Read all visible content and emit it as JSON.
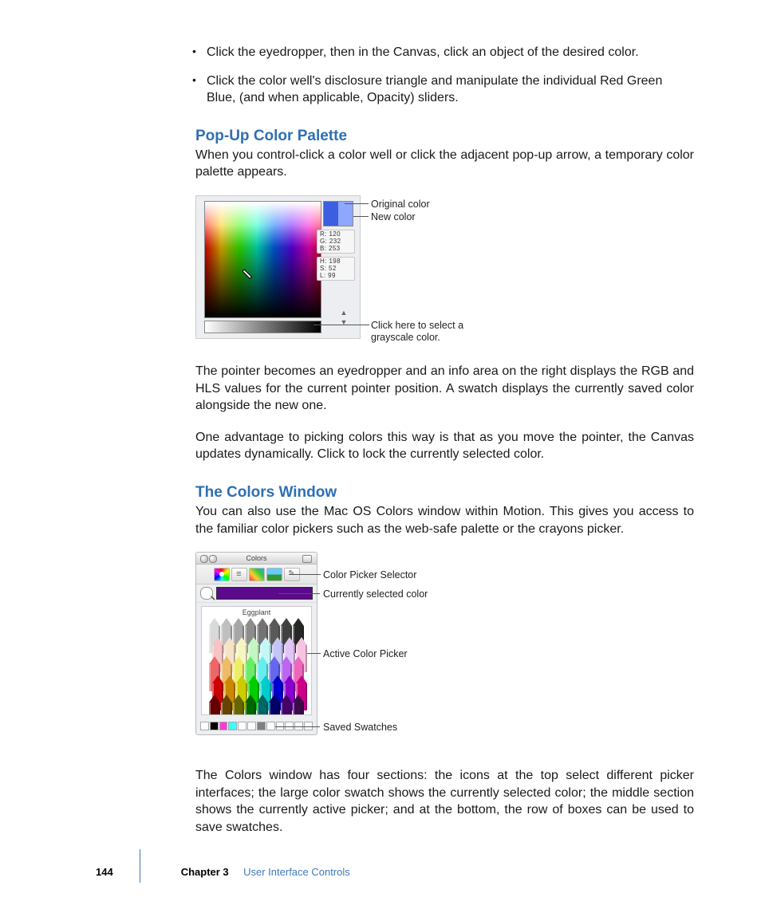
{
  "bullets": [
    "Click the eyedropper, then in the Canvas, click an object of the desired color.",
    "Click the color well's disclosure triangle and manipulate the individual Red Green Blue, (and when applicable, Opacity) sliders."
  ],
  "section1": {
    "heading": "Pop-Up Color Palette",
    "intro": "When you control-click a color well or click the adjacent pop-up arrow, a temporary color palette appears.",
    "callouts": {
      "original": "Original color",
      "new": "New color",
      "grayscale": "Click here to select a grayscale color."
    },
    "readout": {
      "rgb": {
        "R": "120",
        "G": "232",
        "B": "253"
      },
      "hls": {
        "H": "198",
        "S": "52",
        "L": "99"
      }
    },
    "para1": "The pointer becomes an eyedropper and an info area on the right displays the RGB and HLS values for the current pointer position. A swatch displays the currently saved color alongside the new one.",
    "para2": "One advantage to picking colors this way is that as you move the pointer, the Canvas updates dynamically. Click to lock the currently selected color."
  },
  "section2": {
    "heading": "The Colors Window",
    "intro": "You can also use the Mac OS Colors window within Motion. This gives you access to the familiar color pickers such as the web-safe palette or the crayons picker.",
    "window_title": "Colors",
    "crayon_label": "Eggplant",
    "callouts": {
      "selector": "Color Picker Selector",
      "current": "Currently selected color",
      "active": "Active Color Picker",
      "saved": "Saved Swatches"
    },
    "crayon_colors": [
      [
        "#d9d9d9",
        "#bfbfbf",
        "#a6a6a6",
        "#8c8c8c",
        "#737373",
        "#595959",
        "#404040",
        "#262626"
      ],
      [
        "#f6c4c4",
        "#f6e2c4",
        "#f6f6c4",
        "#c4f6c4",
        "#c4f6f6",
        "#c4c4f6",
        "#e2c4f6",
        "#f6c4e2"
      ],
      [
        "#ee6666",
        "#eebb66",
        "#eeee66",
        "#66ee66",
        "#66eeee",
        "#6666ee",
        "#bb66ee",
        "#ee66bb"
      ],
      [
        "#cc0000",
        "#cc8800",
        "#cccc00",
        "#00cc00",
        "#00cccc",
        "#0000cc",
        "#8800cc",
        "#cc0088"
      ],
      [
        "#660000",
        "#664400",
        "#666600",
        "#006600",
        "#006666",
        "#000066",
        "#440066",
        "#3b0a4d"
      ]
    ],
    "saved_swatches": [
      "#ffffff",
      "#000000",
      "#ff3bd6",
      "#35ffff",
      "#ffffff",
      "#ffffff",
      "#808080",
      "#ffffff",
      "#ffffff",
      "#ffffff",
      "#ffffff",
      "#ffffff"
    ],
    "para": "The Colors window has four sections: the icons at the top select different picker interfaces; the large color swatch shows the currently selected color; the middle section shows the currently active picker; and at the bottom, the row of boxes can be used to save swatches."
  },
  "footer": {
    "page": "144",
    "chapter_label": "Chapter 3",
    "chapter_title": "User Interface Controls"
  }
}
